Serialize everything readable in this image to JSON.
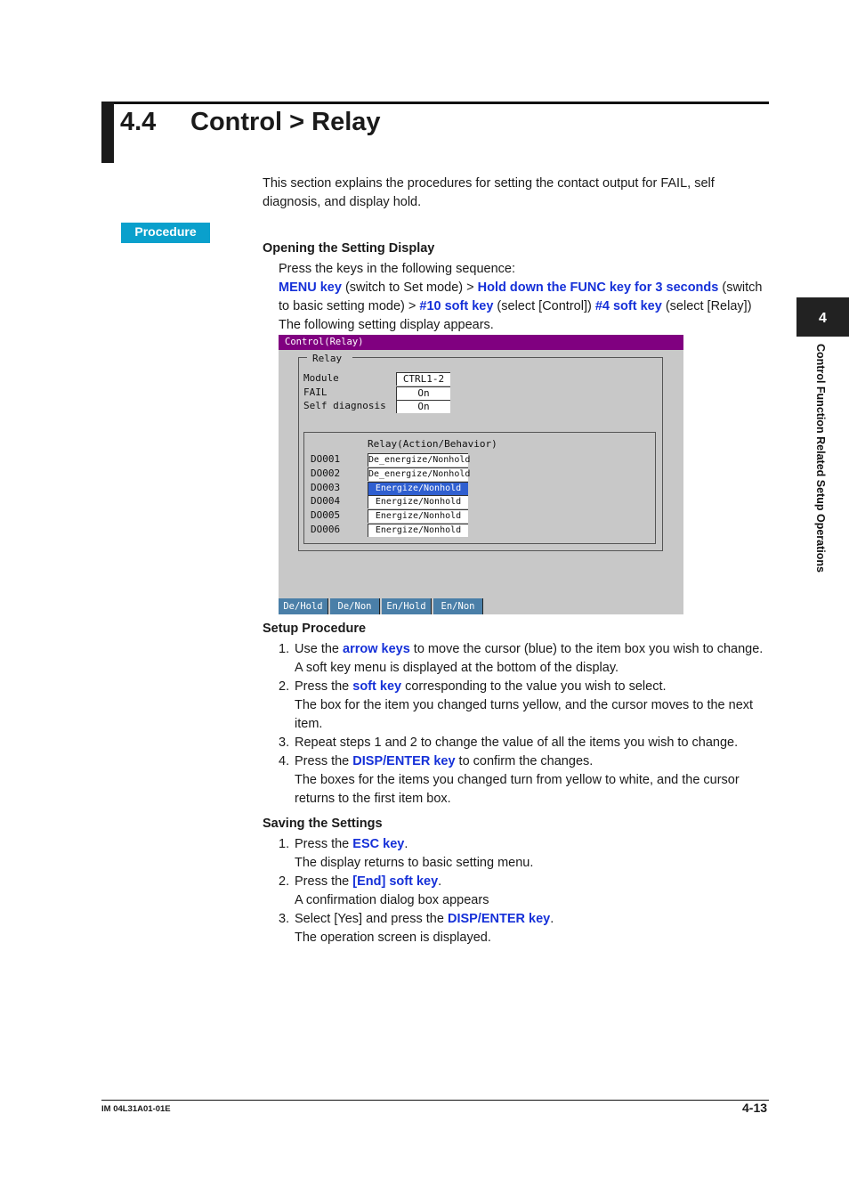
{
  "header": {
    "section_number": "4.4",
    "title": "Control > Relay"
  },
  "intro": "This section explains the procedures for setting the contact output for FAIL, self diagnosis, and display hold.",
  "procedure_badge": "Procedure",
  "opening": {
    "heading": "Opening the Setting Display",
    "line1": "Press the keys in the following sequence:",
    "seq": [
      {
        "t": "k",
        "v": "MENU key"
      },
      {
        "t": "n",
        "v": " (switch to Set mode) > "
      },
      {
        "t": "k",
        "v": "Hold down the FUNC key for 3 seconds"
      },
      {
        "t": "n",
        "v": " (switch to basic setting mode) > "
      },
      {
        "t": "k",
        "v": "#10 soft key"
      },
      {
        "t": "n",
        "v": " (select [Control]) "
      },
      {
        "t": "k",
        "v": "#4 soft key"
      },
      {
        "t": "n",
        "v": " (select [Relay])"
      }
    ],
    "line_after": "The following setting display appears."
  },
  "screen": {
    "title": "Control(Relay)",
    "group_label": "Relay",
    "fields": [
      {
        "label": "Module",
        "value": "CTRL1-2"
      },
      {
        "label": "FAIL",
        "value": "On"
      },
      {
        "label": "Self diagnosis",
        "value": "On"
      }
    ],
    "relay_header": "Relay(Action/Behavior)",
    "relays": [
      {
        "id": "DO001",
        "value": "De_energize/Nonhold",
        "selected": false
      },
      {
        "id": "DO002",
        "value": "De_energize/Nonhold",
        "selected": false
      },
      {
        "id": "DO003",
        "value": "Energize/Nonhold",
        "selected": true
      },
      {
        "id": "DO004",
        "value": "Energize/Nonhold",
        "selected": false
      },
      {
        "id": "DO005",
        "value": "Energize/Nonhold",
        "selected": false
      },
      {
        "id": "DO006",
        "value": "Energize/Nonhold",
        "selected": false
      }
    ],
    "softkeys": [
      "De/Hold",
      "De/Non",
      "En/Hold",
      "En/Non"
    ],
    "colors": {
      "title_bar": "#800080",
      "cursor": "#2f5fd0",
      "softkey": "#4a7fa8"
    }
  },
  "setup": {
    "heading": "Setup Procedure",
    "steps": [
      {
        "num": "1.",
        "parts": [
          {
            "t": "n",
            "v": "Use the "
          },
          {
            "t": "k",
            "v": "arrow keys"
          },
          {
            "t": "n",
            "v": " to move the cursor (blue) to the item box you wish to change."
          }
        ],
        "note": "A soft key menu is displayed at the bottom of the display."
      },
      {
        "num": "2.",
        "parts": [
          {
            "t": "n",
            "v": "Press the "
          },
          {
            "t": "k",
            "v": "soft key"
          },
          {
            "t": "n",
            "v": " corresponding to the value you wish to select."
          }
        ],
        "note": "The box for the item you changed turns yellow, and the cursor moves to the next item."
      },
      {
        "num": "3.",
        "parts": [
          {
            "t": "n",
            "v": "Repeat steps 1 and 2 to change the value of all the items you wish to change."
          }
        ],
        "note": ""
      },
      {
        "num": "4.",
        "parts": [
          {
            "t": "n",
            "v": "Press the "
          },
          {
            "t": "k",
            "v": "DISP/ENTER key"
          },
          {
            "t": "n",
            "v": " to confirm the changes."
          }
        ],
        "note": "The boxes for the items you changed turn from yellow to white, and the cursor returns to the first item box."
      }
    ]
  },
  "saving": {
    "heading": "Saving the Settings",
    "steps": [
      {
        "num": "1.",
        "parts": [
          {
            "t": "n",
            "v": "Press the "
          },
          {
            "t": "k",
            "v": "ESC key"
          },
          {
            "t": "n",
            "v": "."
          }
        ],
        "note": "The display returns to basic setting menu."
      },
      {
        "num": "2.",
        "parts": [
          {
            "t": "n",
            "v": "Press the "
          },
          {
            "t": "k",
            "v": "[End] soft key"
          },
          {
            "t": "n",
            "v": "."
          }
        ],
        "note": "A confirmation dialog box appears"
      },
      {
        "num": "3.",
        "parts": [
          {
            "t": "n",
            "v": "Select [Yes] and press the "
          },
          {
            "t": "k",
            "v": "DISP/ENTER key"
          },
          {
            "t": "n",
            "v": "."
          }
        ],
        "note": "The operation screen is displayed."
      }
    ]
  },
  "side_tab": {
    "number": "4",
    "text": "Control Function Related Setup Operations"
  },
  "footer": {
    "doc_id": "IM 04L31A01-01E",
    "page": "4-13"
  },
  "colors": {
    "key_text": "#1530d8",
    "procedure_badge": "#0aa0cc"
  }
}
